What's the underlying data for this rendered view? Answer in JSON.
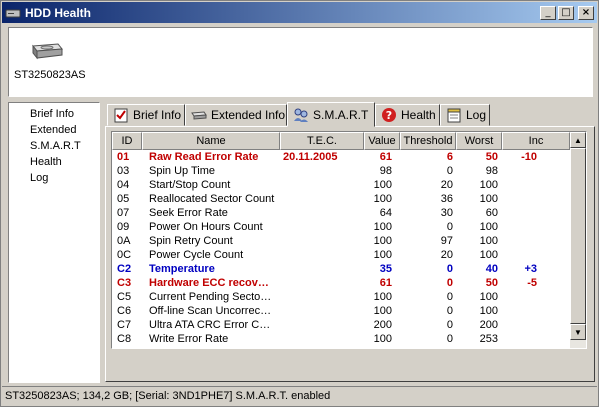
{
  "window": {
    "title": "HDD Health"
  },
  "drive": {
    "name": "ST3250823AS"
  },
  "nav": {
    "items": [
      "Brief Info",
      "Extended",
      "S.M.A.R.T",
      "Health",
      "Log"
    ]
  },
  "tabs": [
    {
      "label": "Brief Info",
      "icon": "checklist-icon"
    },
    {
      "label": "Extended Info",
      "icon": "drive-icon"
    },
    {
      "label": "S.M.A.R.T",
      "icon": "users-icon"
    },
    {
      "label": "Health",
      "icon": "help-icon"
    },
    {
      "label": "Log",
      "icon": "notepad-icon"
    }
  ],
  "smart": {
    "columns": [
      "ID",
      "Name",
      "T.E.C.",
      "Value",
      "Threshold",
      "Worst",
      "Inc"
    ],
    "rows": [
      {
        "id": "01",
        "name": "Raw Read Error Rate",
        "tec": "20.11.2005",
        "value": "61",
        "threshold": "6",
        "worst": "50",
        "inc": "-10",
        "style": "crit"
      },
      {
        "id": "03",
        "name": "Spin Up Time",
        "tec": "",
        "value": "98",
        "threshold": "0",
        "worst": "98",
        "inc": "",
        "style": ""
      },
      {
        "id": "04",
        "name": "Start/Stop Count",
        "tec": "",
        "value": "100",
        "threshold": "20",
        "worst": "100",
        "inc": "",
        "style": ""
      },
      {
        "id": "05",
        "name": "Reallocated Sector Count",
        "tec": "",
        "value": "100",
        "threshold": "36",
        "worst": "100",
        "inc": "",
        "style": ""
      },
      {
        "id": "07",
        "name": "Seek Error Rate",
        "tec": "",
        "value": "64",
        "threshold": "30",
        "worst": "60",
        "inc": "",
        "style": ""
      },
      {
        "id": "09",
        "name": "Power On Hours Count",
        "tec": "",
        "value": "100",
        "threshold": "0",
        "worst": "100",
        "inc": "",
        "style": ""
      },
      {
        "id": "0A",
        "name": "Spin Retry Count",
        "tec": "",
        "value": "100",
        "threshold": "97",
        "worst": "100",
        "inc": "",
        "style": ""
      },
      {
        "id": "0C",
        "name": "Power Cycle Count",
        "tec": "",
        "value": "100",
        "threshold": "20",
        "worst": "100",
        "inc": "",
        "style": ""
      },
      {
        "id": "C2",
        "name": "Temperature",
        "tec": "",
        "value": "35",
        "threshold": "0",
        "worst": "40",
        "inc": "+3",
        "style": "info"
      },
      {
        "id": "C3",
        "name": "Hardware ECC recov…",
        "tec": "",
        "value": "61",
        "threshold": "0",
        "worst": "50",
        "inc": "-5",
        "style": "crit"
      },
      {
        "id": "C5",
        "name": "Current Pending Secto…",
        "tec": "",
        "value": "100",
        "threshold": "0",
        "worst": "100",
        "inc": "",
        "style": ""
      },
      {
        "id": "C6",
        "name": "Off-line Scan Uncorrec…",
        "tec": "",
        "value": "100",
        "threshold": "0",
        "worst": "100",
        "inc": "",
        "style": ""
      },
      {
        "id": "C7",
        "name": "Ultra ATA CRC Error C…",
        "tec": "",
        "value": "200",
        "threshold": "0",
        "worst": "200",
        "inc": "",
        "style": ""
      },
      {
        "id": "C8",
        "name": "Write Error Rate",
        "tec": "",
        "value": "100",
        "threshold": "0",
        "worst": "253",
        "inc": "",
        "style": ""
      }
    ]
  },
  "status": {
    "text": "ST3250823AS;  134,2 GB;  [Serial: 3ND1PHE7]   S.M.A.R.T. enabled"
  }
}
